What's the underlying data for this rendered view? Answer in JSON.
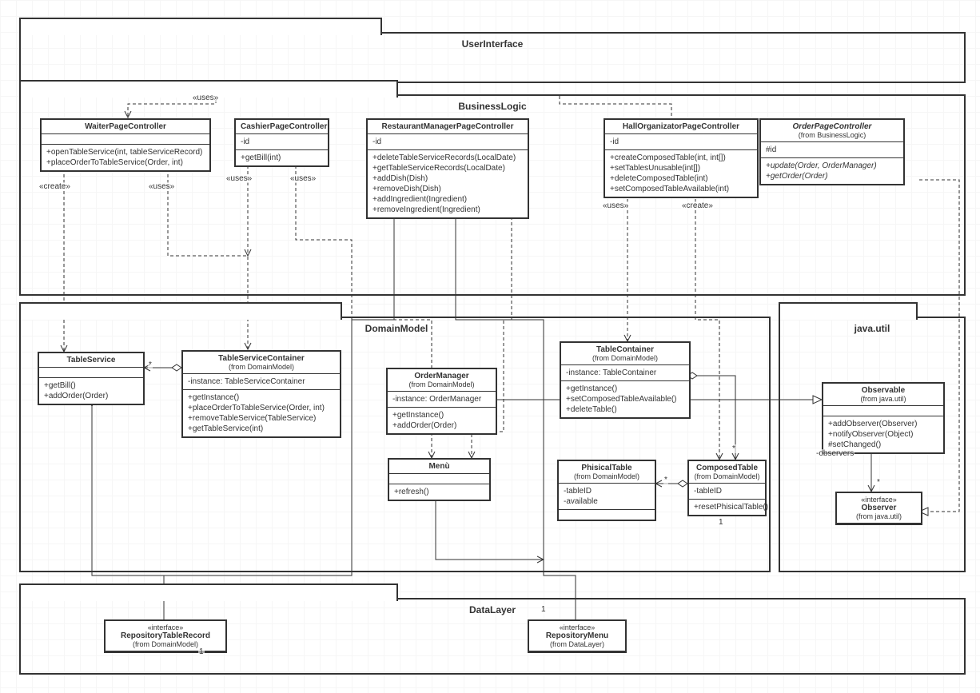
{
  "packages": {
    "userInterface": {
      "title": "UserInterface"
    },
    "businessLogic": {
      "title": "BusinessLogic"
    },
    "domainModel": {
      "title": "DomainModel"
    },
    "javaUtil": {
      "title": "java.util"
    },
    "dataLayer": {
      "title": "DataLayer"
    }
  },
  "classes": {
    "waiterPageController": {
      "name": "WaiterPageController",
      "ops": "+openTableService(int, tableServiceRecord)\n+placeOrderToTableService(Order, int)"
    },
    "cashierPageController": {
      "name": "CashierPageController",
      "attrs": "-id",
      "ops": "+getBill(int)"
    },
    "restaurantManagerPageController": {
      "name": "RestaurantManagerPageController",
      "attrs": "-id",
      "ops": "+deleteTableServiceRecords(LocalDate)\n+getTableServiceRecords(LocalDate)\n+addDish(Dish)\n+removeDish(Dish)\n+addIngredient(Ingredient)\n+removeIngredient(Ingredient)"
    },
    "hallOrganizatorPageController": {
      "name": "HallOrganizatorPageController",
      "attrs": "-id",
      "ops": "+createComposedTable(int, int[])\n+setTablesUnusable(int[])\n+deleteComposedTable(int)\n+setComposedTableAvailable(int)"
    },
    "orderPageController": {
      "name": "OrderPageController",
      "from": "(from BusinessLogic)",
      "attrs": "#id",
      "ops": "+update(Order, OrderManager)\n+getOrder(Order)"
    },
    "tableService": {
      "name": "TableService",
      "ops": "+getBill()\n+addOrder(Order)"
    },
    "tableServiceContainer": {
      "name": "TableServiceContainer",
      "from": "(from DomainModel)",
      "attrs": "-instance: TableServiceContainer",
      "ops": "+getInstance()\n+placeOrderToTableService(Order, int)\n+removeTableService(TableService)\n+getTableService(int)"
    },
    "orderManager": {
      "name": "OrderManager",
      "from": "(from DomainModel)",
      "attrs": "-instance: OrderManager",
      "ops": "+getInstance()\n+addOrder(Order)"
    },
    "tableContainer": {
      "name": "TableContainer",
      "from": "(from DomainModel)",
      "attrs": "-instance: TableContainer",
      "ops": "+getInstance()\n+setComposedTableAvailable()\n+deleteTable()"
    },
    "menu": {
      "name": "Menù",
      "ops": "+refresh()"
    },
    "phisicalTable": {
      "name": "PhisicalTable",
      "from": "(from DomainModel)",
      "attrs": "-tableID\n-available"
    },
    "composedTable": {
      "name": "ComposedTable",
      "from": "(from DomainModel)",
      "attrs": "-tableID",
      "ops": "+resetPhisicalTable()"
    },
    "observable": {
      "name": "Observable",
      "from": "(from java.util)",
      "ops": "+addObserver(Observer)\n+notifyObserver(Object)\n#setChanged()"
    },
    "observer": {
      "name": "Observer",
      "from": "(from java.util)",
      "stereo": "«interface»"
    },
    "repositoryTableRecord": {
      "name": "RepositoryTableRecord",
      "from": "(from DomainModel)",
      "stereo": "«interface»"
    },
    "repositoryMenu": {
      "name": "RepositoryMenu",
      "from": "(from DataLayer)",
      "stereo": "«interface»"
    }
  },
  "labels": {
    "uses1": "«uses»",
    "uses2": "«uses»",
    "uses3": "«uses»",
    "uses4": "«uses»",
    "uses5": "«uses»",
    "create1": "«create»",
    "create2": "«create»",
    "star1": "*",
    "star2": "*",
    "star3": "*",
    "star4": "*",
    "one1": "1",
    "one2": "1",
    "one3": "1",
    "observers": "-observers"
  }
}
